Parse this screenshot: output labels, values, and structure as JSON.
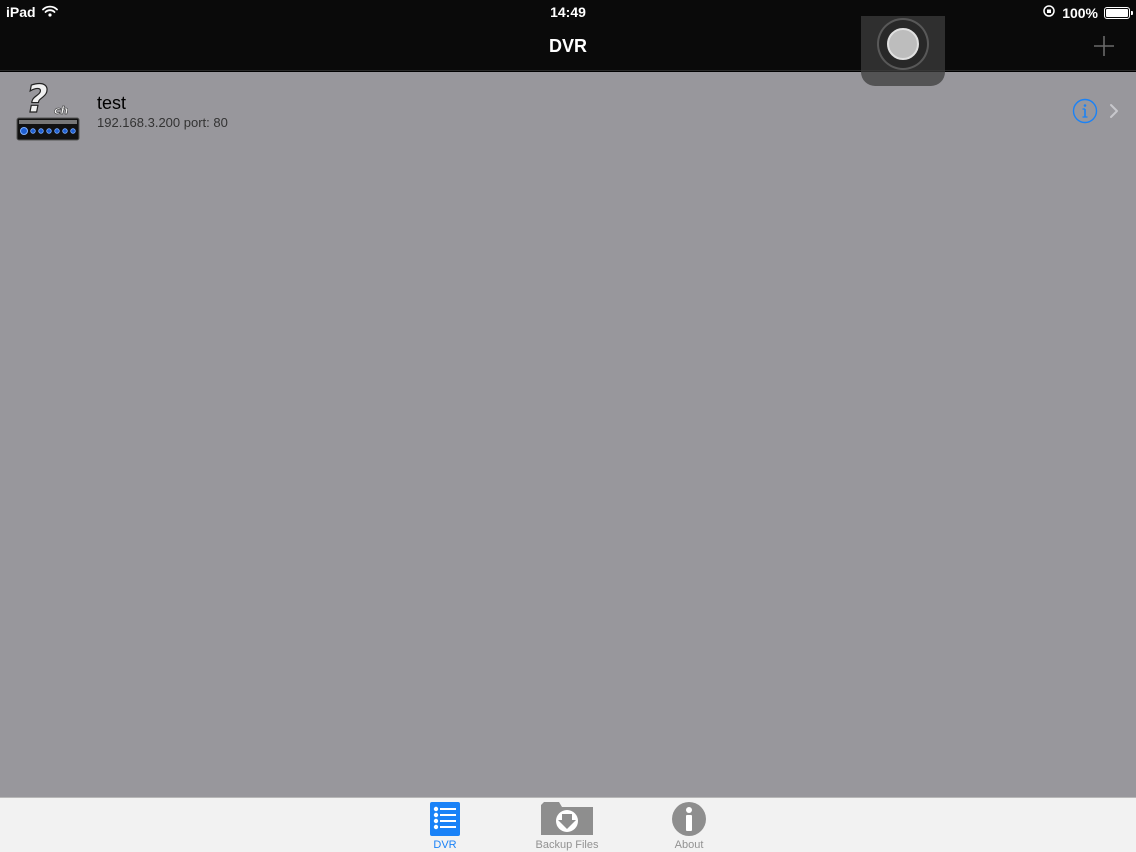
{
  "status_bar": {
    "device": "iPad",
    "time": "14:49",
    "battery": "100%",
    "battery_level": 1.0
  },
  "nav": {
    "title": "DVR",
    "add_icon": "plus-icon"
  },
  "dvr_list": [
    {
      "name": "test",
      "address": "192.168.3.200 port: 80",
      "thumb_badge": "ch"
    }
  ],
  "tabs": [
    {
      "label": "DVR",
      "icon": "list-icon",
      "active": true
    },
    {
      "label": "Backup Files",
      "icon": "folder-download-icon",
      "active": false
    },
    {
      "label": "About",
      "icon": "info-icon",
      "active": false
    }
  ],
  "colors": {
    "accent": "#1a82f7",
    "content_bg": "#98979c",
    "bar_bg": "#0a0a0a",
    "tab_bar_bg": "#f2f2f2"
  }
}
